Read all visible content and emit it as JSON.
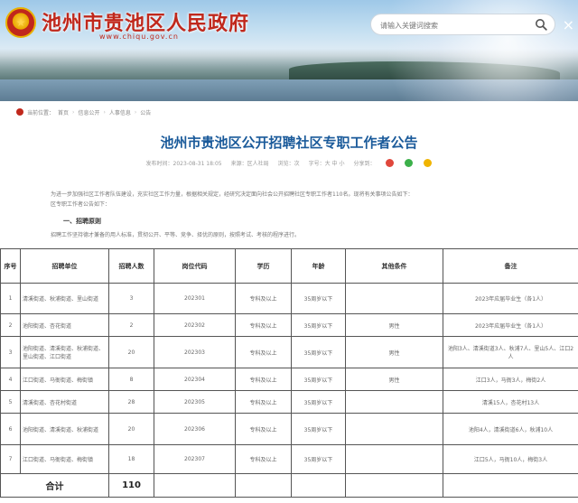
{
  "banner": {
    "emblem_text": "★",
    "site_title": "池州市贵池区人民政府",
    "site_url": "www.chiqu.gov.cn",
    "search_placeholder": "请输入关键词搜索",
    "close_glyph": "×"
  },
  "breadcrumb": {
    "items": [
      "当前位置：",
      "首页",
      "信息公开",
      "人事信息",
      "公告"
    ],
    "separator": "›"
  },
  "article": {
    "title": "池州市贵池区公开招聘社区专职工作者公告",
    "meta": {
      "date": "发布时间：2023-08-31 18:05",
      "source": "来源：区人社局",
      "views": "浏览：次",
      "font": "字号：大 中 小",
      "share_label": "分享到："
    },
    "intro_line1": "为进一步加强社区工作者队伍建设，充实社区工作力量，根据相关规定，经研究决定面向社会公开招聘社区专职工作者110名。现将有关事项公告如下：",
    "intro_line2": "区专职工作者公告如下：",
    "section1_title": "一、招聘原则",
    "section1_body": "招聘工作坚持德才兼备的用人标准，贯彻公开、平等、竞争、择优的原则，按照考试、考核的程序进行。"
  },
  "table": {
    "headers": [
      "序号",
      "招聘单位",
      "招聘人数",
      "岗位代码",
      "学历",
      "年龄",
      "其他条件",
      "备注"
    ],
    "rows": [
      {
        "no": "1",
        "unit": "清溪街道、秋浦街道、里山街道",
        "count": "3",
        "code": "202301",
        "edu": "专科及以上",
        "age": "35周岁以下",
        "other": "",
        "note": "2023年应届毕业生（各1人）"
      },
      {
        "no": "2",
        "unit": "池阳街道、杏花街道",
        "count": "2",
        "code": "202302",
        "edu": "专科及以上",
        "age": "35周岁以下",
        "other": "男性",
        "note": "2023年应届毕业生（各1人）"
      },
      {
        "no": "3",
        "unit": "池阳街道、清溪街道、秋浦街道、里山街道、江口街道",
        "count": "20",
        "code": "202303",
        "edu": "专科及以上",
        "age": "35周岁以下",
        "other": "男性",
        "note": "池阳3人、清溪街道3人、秋浦7人、里山5人、江口2人"
      },
      {
        "no": "4",
        "unit": "江口街道、马衙街道、梅街镇",
        "count": "8",
        "code": "202304",
        "edu": "专科及以上",
        "age": "35周岁以下",
        "other": "男性",
        "note": "江口3人，马衙3人，梅街2人"
      },
      {
        "no": "5",
        "unit": "清溪街道、杏花村街道",
        "count": "28",
        "code": "202305",
        "edu": "专科及以上",
        "age": "35周岁以下",
        "other": "",
        "note": "清溪15人，杏花村13人"
      },
      {
        "no": "6",
        "unit": "池阳街道、清溪街道、秋浦街道",
        "count": "20",
        "code": "202306",
        "edu": "专科及以上",
        "age": "35周岁以下",
        "other": "",
        "note": "池阳4人，清溪街道6人，秋浦10人"
      },
      {
        "no": "7",
        "unit": "江口街道、马衙街道、梅街镇",
        "count": "18",
        "code": "202307",
        "edu": "专科及以上",
        "age": "35周岁以下",
        "other": "",
        "note": "江口5人，马衙10人，梅街3人"
      }
    ],
    "total_label": "合计",
    "total_value": "110"
  },
  "colors": {
    "brand_red": "#c0281c",
    "title_blue": "#1a5a9a",
    "share_red": "#e0473c",
    "share_green": "#3cb04a",
    "share_yellow": "#f0b400"
  },
  "icons": [
    "emblem-icon",
    "search-icon",
    "close-icon",
    "home-icon",
    "share-weibo-icon",
    "share-wechat-icon",
    "share-qzone-icon"
  ]
}
